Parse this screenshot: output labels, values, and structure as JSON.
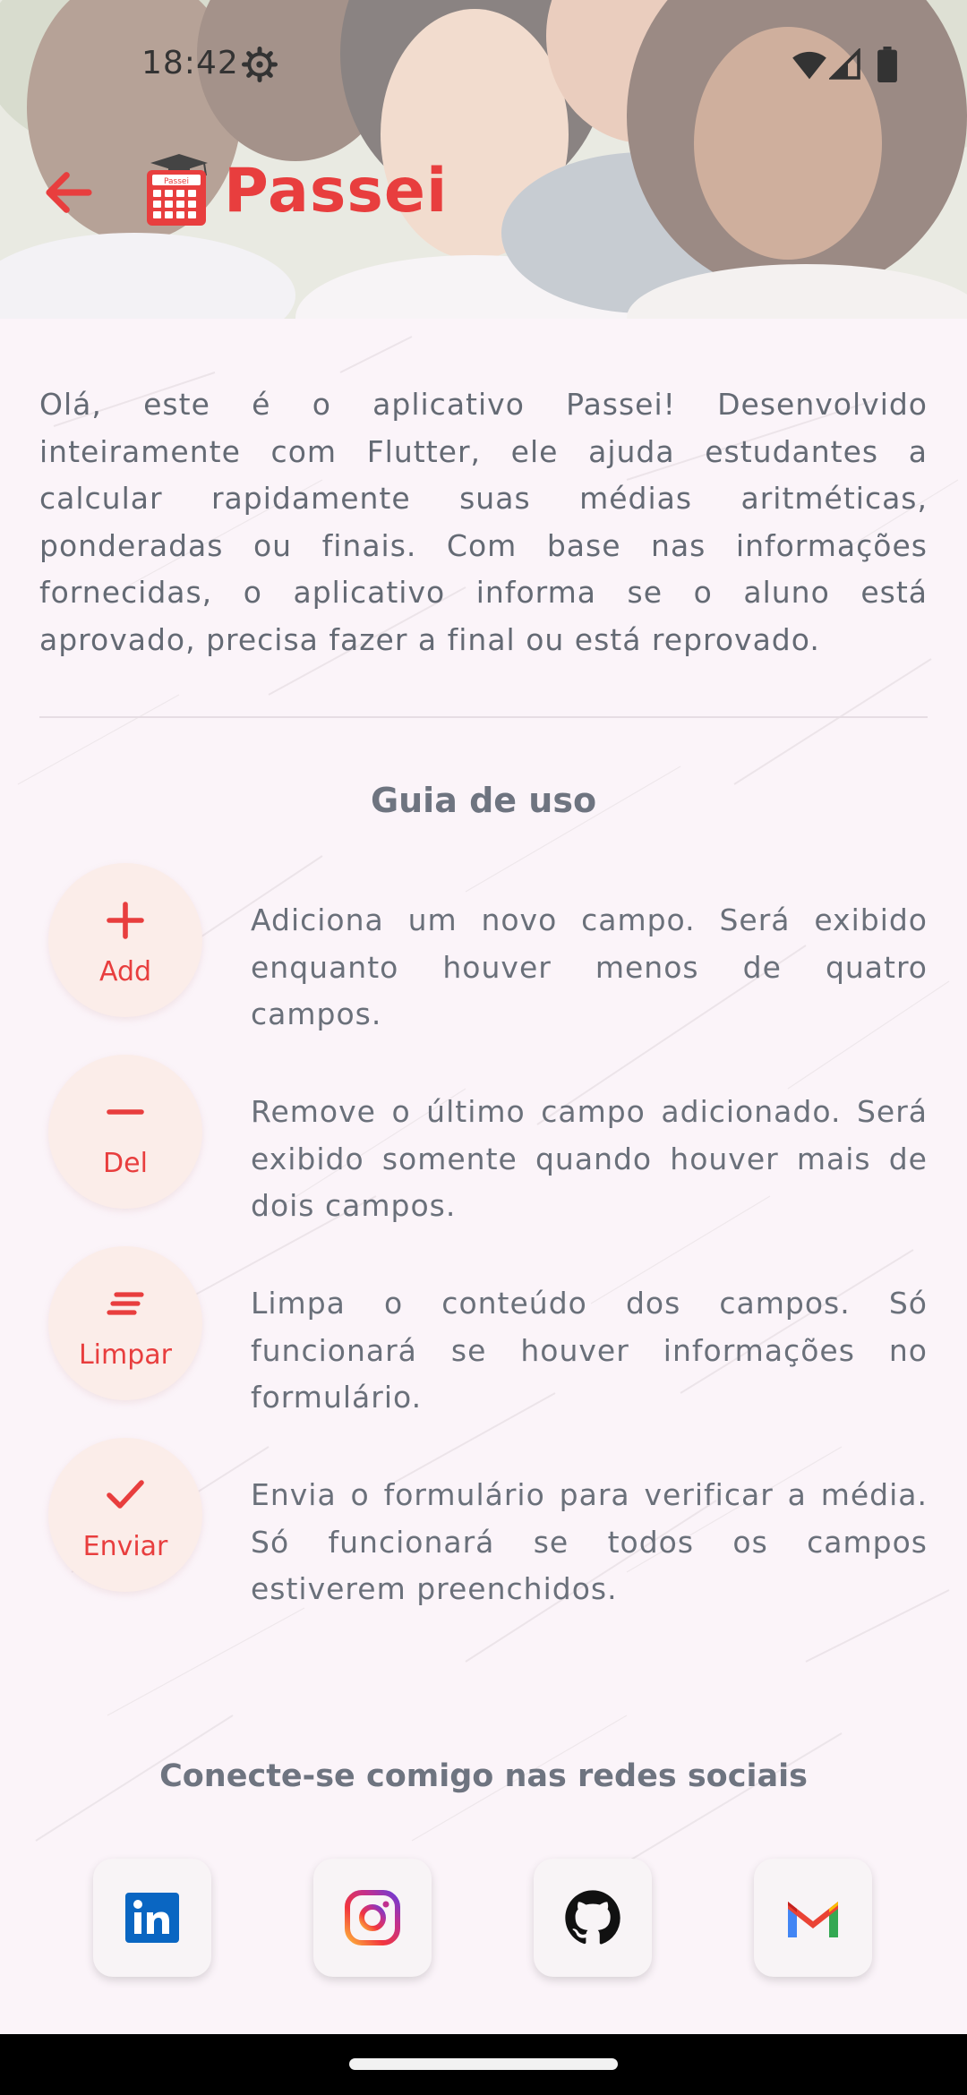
{
  "status_bar": {
    "time": "18:42",
    "icons": [
      "settings-gear-icon",
      "wifi-icon",
      "cellular-signal-icon",
      "battery-icon"
    ]
  },
  "app_bar": {
    "back_icon": "arrow-back-icon",
    "logo_icon": "calculator-graduation-cap-icon",
    "logo_text": "Passei",
    "title": "Passei"
  },
  "intro_text": "Olá, este é o aplicativo Passei! Desenvolvido inteiramente com Flutter, ele ajuda estudantes a calcular rapidamente suas médias aritméticas, ponderadas ou finais. Com base nas informações fornecidas, o aplicativo informa se o aluno está aprovado, precisa fazer a final ou está reprovado.",
  "guide": {
    "title": "Guia de uso",
    "items": [
      {
        "icon": "plus-icon",
        "label": "Add",
        "description": "Adiciona um novo campo. Será exibido enquanto houver menos de quatro campos."
      },
      {
        "icon": "minus-icon",
        "label": "Del",
        "description": "Remove o último campo adicionado. Será exibido somente quando houver mais de dois campos."
      },
      {
        "icon": "clear-all-icon",
        "label": "Limpar",
        "description": "Limpa o conteúdo dos campos. Só funcionará se houver informações no formulário."
      },
      {
        "icon": "check-icon",
        "label": "Enviar",
        "description": "Envia o formulário para verificar a média. Só funcionará se todos os campos estiverem preenchidos."
      }
    ]
  },
  "social": {
    "title": "Conecte-se comigo nas redes sociais",
    "links": [
      {
        "icon": "linkedin-icon"
      },
      {
        "icon": "instagram-icon"
      },
      {
        "icon": "github-icon"
      },
      {
        "icon": "gmail-icon"
      }
    ]
  },
  "colors": {
    "accent": "#e83e3e",
    "text": "#646a74",
    "background": "#fbf4f9",
    "button_bg": "#fbede9"
  }
}
